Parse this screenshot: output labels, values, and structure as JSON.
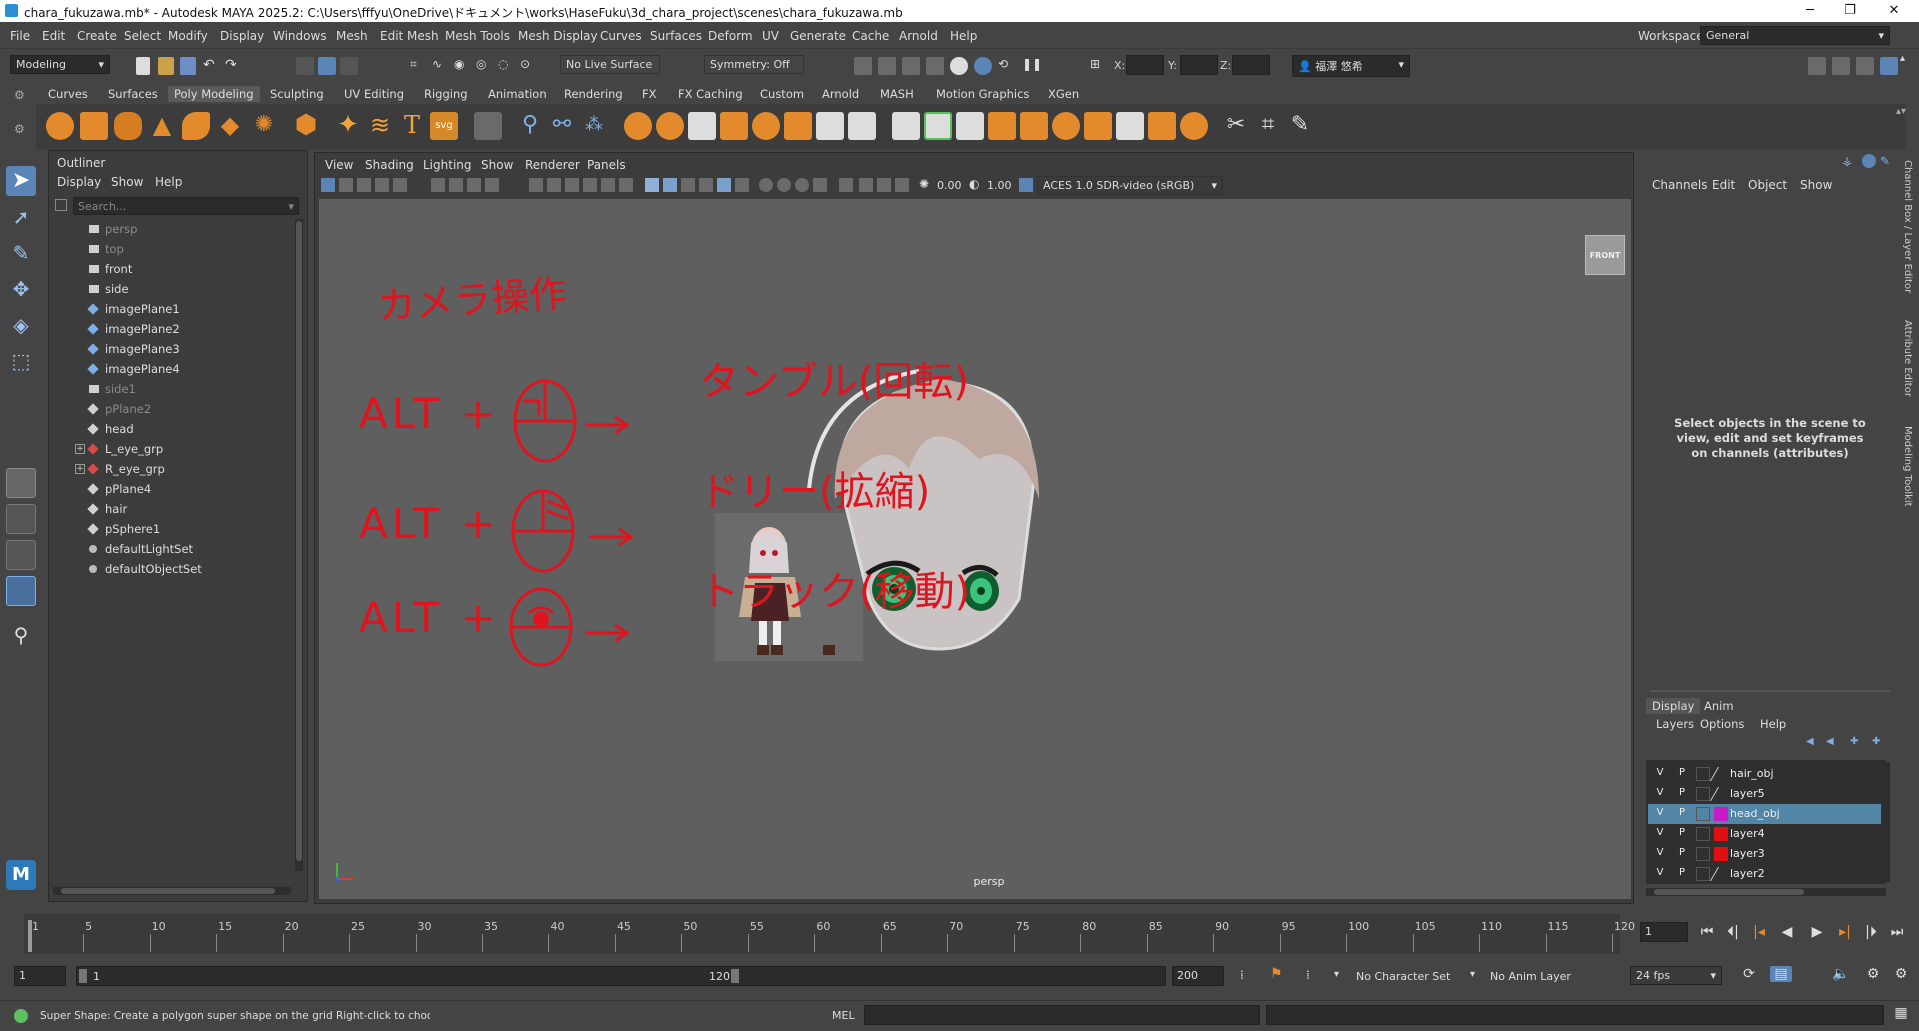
{
  "window": {
    "title": "chara_fukuzawa.mb* - Autodesk MAYA 2025.2: C:\\Users\\fffyu\\OneDrive\\ドキュメント\\works\\HaseFuku\\3d_chara_project\\scenes\\chara_fukuzawa.mb",
    "minimize": "─",
    "maximize": "❐",
    "close": "✕"
  },
  "menubar": {
    "items": [
      "File",
      "Edit",
      "Create",
      "Select",
      "Modify",
      "Display",
      "Windows",
      "Mesh",
      "Edit Mesh",
      "Mesh Tools",
      "Mesh Display",
      "Curves",
      "Surfaces",
      "Deform",
      "UV",
      "Generate",
      "Cache",
      "Arnold",
      "Help"
    ],
    "workspace_label": "Workspace:",
    "workspace_value": "General"
  },
  "statusline": {
    "mode": "Modeling",
    "live_surface": "No Live Surface",
    "symmetry": "Symmetry: Off",
    "x_label": "X:",
    "y_label": "Y:",
    "z_label": "Z:",
    "user": "福澤 悠希"
  },
  "shelf": {
    "tabs": [
      "Curves",
      "Surfaces",
      "Poly Modeling",
      "Sculpting",
      "UV Editing",
      "Rigging",
      "Animation",
      "Rendering",
      "FX",
      "FX Caching",
      "Custom",
      "Arnold",
      "MASH",
      "Motion Graphics",
      "XGen"
    ],
    "active_tab": "Poly Modeling",
    "svg_label": "svg"
  },
  "outliner": {
    "title": "Outliner",
    "menus": [
      "Display",
      "Show",
      "Help"
    ],
    "search_placeholder": "Search...",
    "items": [
      {
        "label": "persp",
        "dim": true
      },
      {
        "label": "top",
        "dim": true
      },
      {
        "label": "front",
        "dim": false
      },
      {
        "label": "side",
        "dim": false
      },
      {
        "label": "imagePlane1",
        "dim": false
      },
      {
        "label": "imagePlane2",
        "dim": false
      },
      {
        "label": "imagePlane3",
        "dim": false
      },
      {
        "label": "imagePlane4",
        "dim": false
      },
      {
        "label": "side1",
        "dim": true
      },
      {
        "label": "pPlane2",
        "dim": true
      },
      {
        "label": "head",
        "dim": false
      },
      {
        "label": "L_eye_grp",
        "dim": false
      },
      {
        "label": "R_eye_grp",
        "dim": false
      },
      {
        "label": "pPlane4",
        "dim": false
      },
      {
        "label": "hair",
        "dim": false
      },
      {
        "label": "pSphere1",
        "dim": false
      },
      {
        "label": "defaultLightSet",
        "dim": false
      },
      {
        "label": "defaultObjectSet",
        "dim": false
      }
    ]
  },
  "viewport": {
    "menus": [
      "View",
      "Shading",
      "Lighting",
      "Show",
      "Renderer",
      "Panels"
    ],
    "exposure": "0.00",
    "gamma": "1.00",
    "color_space": "ACES 1.0 SDR-video (sRGB)",
    "camera_label": "persp",
    "viewcube": "FRONT",
    "annotation": {
      "title": "カメラ操作",
      "line1_prefix": "ALT +",
      "line1_action": "タンブル(回転)",
      "line2_prefix": "ALT +",
      "line2_action": "ドリー(拡縮)",
      "line3_prefix": "ALT +",
      "line3_action": "トラック(移動)",
      "ink_color": "#e0141e"
    }
  },
  "channelbox": {
    "menus": [
      "Channels",
      "Edit",
      "Object",
      "Show"
    ],
    "message": "Select objects in the scene to view, edit and set keyframes on channels (attributes)",
    "layer_tabs": [
      "Display",
      "Anim"
    ],
    "layer_menus": [
      "Layers",
      "Options",
      "Help"
    ],
    "layers": [
      {
        "name": "hair_obj",
        "v": "V",
        "p": "P",
        "color": "",
        "selected": false
      },
      {
        "name": "layer5",
        "v": "V",
        "p": "P",
        "color": "",
        "selected": false
      },
      {
        "name": "head_obj",
        "v": "V",
        "p": "P",
        "color": "#c81bc8",
        "selected": true
      },
      {
        "name": "layer4",
        "v": "V",
        "p": "P",
        "color": "#e01010",
        "selected": false
      },
      {
        "name": "layer3",
        "v": "V",
        "p": "P",
        "color": "#e01010",
        "selected": false
      },
      {
        "name": "layer2",
        "v": "V",
        "p": "P",
        "color": "",
        "selected": false
      }
    ]
  },
  "vertical_tabs": [
    "Channel Box / Layer Editor",
    "Attribute Editor",
    "Modeling Toolkit"
  ],
  "timeslider": {
    "ticks": [
      "1",
      "5",
      "10",
      "15",
      "20",
      "25",
      "30",
      "35",
      "40",
      "45",
      "50",
      "55",
      "60",
      "65",
      "70",
      "75",
      "80",
      "85",
      "90",
      "95",
      "100",
      "105",
      "110",
      "115",
      "120"
    ],
    "current_frame": "1"
  },
  "rangeslider": {
    "start": "1",
    "inner_start": "1",
    "inner_end": "120",
    "end": "200",
    "character_set": "No Character Set",
    "anim_layer": "No Anim Layer",
    "fps": "24 fps"
  },
  "helpline": {
    "text": "Super Shape: Create a polygon super shape on the grid Right-click to choose shape type",
    "command_label": "MEL"
  },
  "maya_logo": "M"
}
